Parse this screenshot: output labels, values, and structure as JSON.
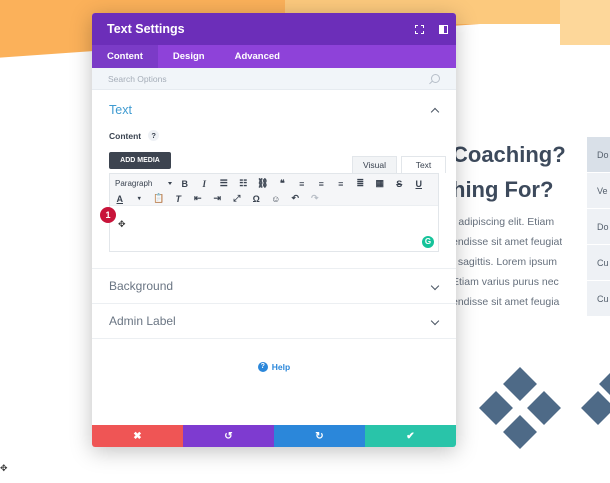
{
  "background_page": {
    "heading_line1": "Coaching?",
    "heading_line2": "hing For?",
    "paragraph_lines": [
      "r adipiscing elit. Etiam",
      "endisse sit amet feugiat",
      "t sagittis. Lorem ipsum",
      "Etiam varius purus nec",
      "endisse sit amet feugia"
    ],
    "list_items": [
      "Do",
      "Ve",
      "Do",
      "Cu",
      "Cu"
    ]
  },
  "modal": {
    "title": "Text Settings",
    "tabs": [
      {
        "label": "Content",
        "active": true
      },
      {
        "label": "Design",
        "active": false
      },
      {
        "label": "Advanced",
        "active": false
      }
    ],
    "search": {
      "placeholder": "Search Options"
    },
    "text_section": {
      "title": "Text",
      "content_label": "Content",
      "help_glyph": "?",
      "add_media_label": "ADD MEDIA",
      "editor_tabs": [
        {
          "label": "Visual",
          "active": false
        },
        {
          "label": "Text",
          "active": true
        }
      ],
      "paragraph_select": "Paragraph",
      "badge_number": "1"
    },
    "sections": [
      {
        "label": "Background"
      },
      {
        "label": "Admin Label"
      }
    ],
    "help_label": "Help"
  },
  "colors": {
    "header": "#6c2eb9",
    "tabs": "#8e42d9",
    "cancel": "#ef5555",
    "undo": "#7e3bd0",
    "redo": "#2b87da",
    "save": "#29c4a9"
  }
}
